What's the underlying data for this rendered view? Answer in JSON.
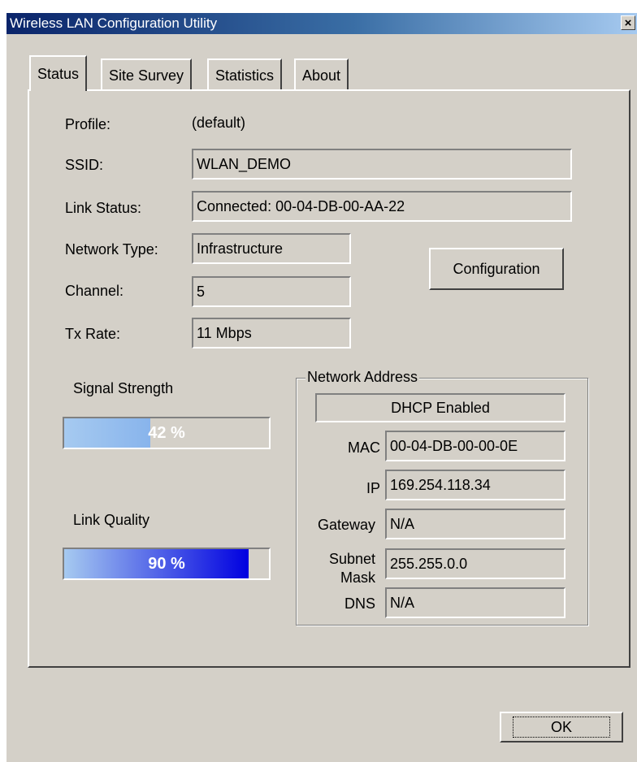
{
  "window": {
    "title": "Wireless LAN Configuration Utility",
    "close_glyph": "×"
  },
  "tabs": [
    {
      "label": "Status",
      "active": true
    },
    {
      "label": "Site Survey",
      "active": false
    },
    {
      "label": "Statistics",
      "active": false
    },
    {
      "label": "About",
      "active": false
    }
  ],
  "status": {
    "profile_label": "Profile:",
    "profile_value": "(default)",
    "ssid_label": "SSID:",
    "ssid_value": "WLAN_DEMO",
    "link_status_label": "Link Status:",
    "link_status_value": "Connected: 00-04-DB-00-AA-22",
    "network_type_label": "Network Type:",
    "network_type_value": "Infrastructure",
    "channel_label": "Channel:",
    "channel_value": "5",
    "tx_rate_label": "Tx Rate:",
    "tx_rate_value": "11 Mbps",
    "configuration_button": "Configuration"
  },
  "signal": {
    "label": "Signal Strength",
    "percent": 42,
    "text": "42 %"
  },
  "quality": {
    "label": "Link Quality",
    "percent": 90,
    "text": "90 %"
  },
  "network_address": {
    "legend": "Network Address",
    "dhcp": "DHCP Enabled",
    "mac_label": "MAC",
    "mac_value": "00-04-DB-00-00-0E",
    "ip_label": "IP",
    "ip_value": "169.254.118.34",
    "gateway_label": "Gateway",
    "gateway_value": "N/A",
    "subnet_label_1": "Subnet",
    "subnet_label_2": "Mask",
    "subnet_value": "255.255.0.0",
    "dns_label": "DNS",
    "dns_value": "N/A"
  },
  "ok_button": "OK",
  "colors": {
    "title_gradient_start": "#0a246a",
    "signal_fill": "#a6caf0",
    "quality_fill_start": "#a6caf0",
    "quality_fill_end": "#0000e0"
  }
}
